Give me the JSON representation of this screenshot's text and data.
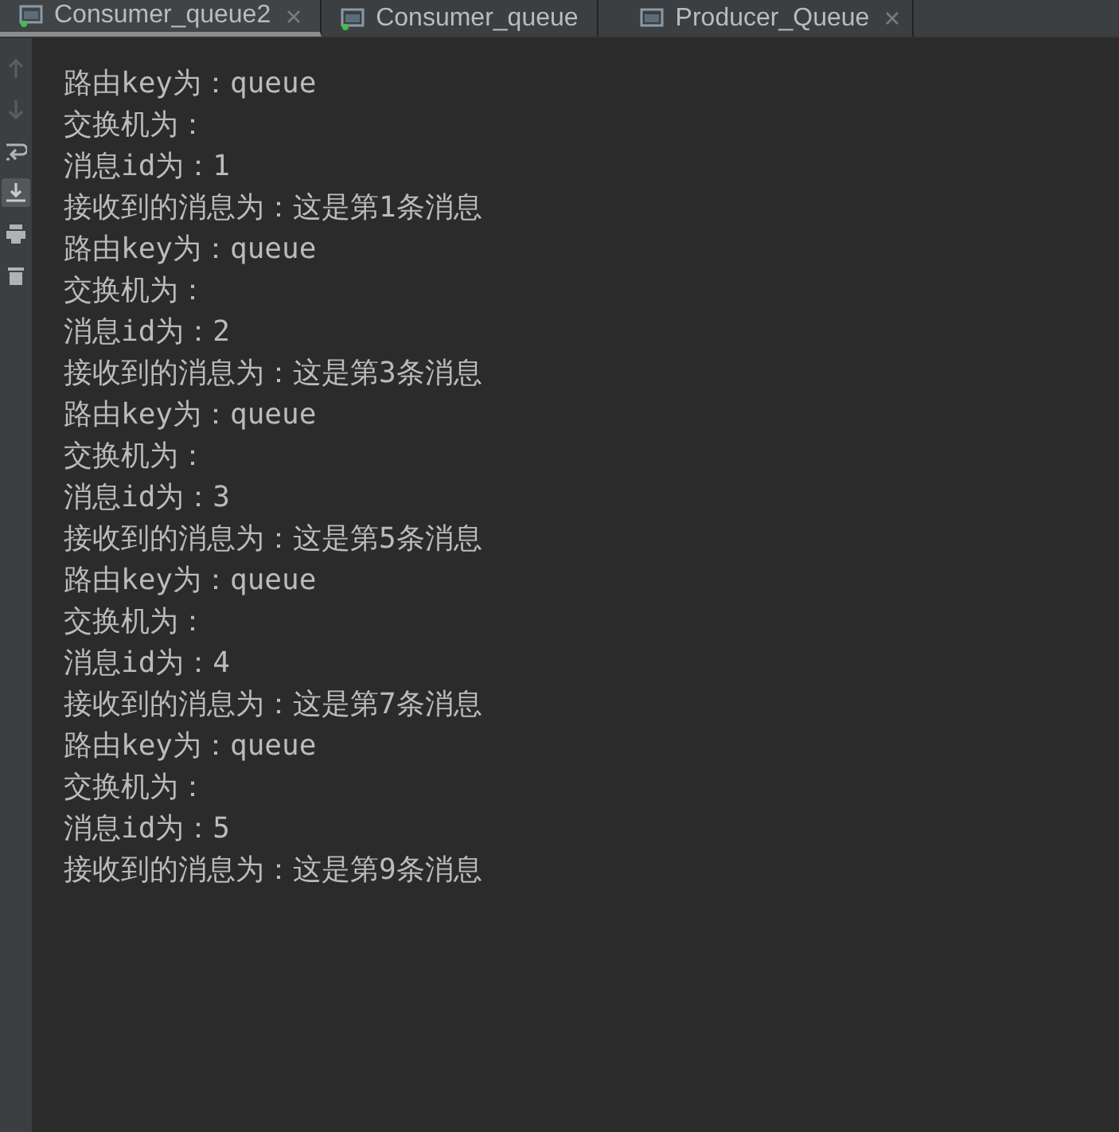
{
  "tabs": [
    {
      "label": "Consumer_queue2",
      "selected": true,
      "running": true,
      "closable": true
    },
    {
      "label": "Consumer_queue",
      "selected": false,
      "running": true,
      "closable": false
    },
    {
      "label": "Producer_Queue",
      "selected": false,
      "running": false,
      "closable": true
    }
  ],
  "toolbar": [
    {
      "kind": "up",
      "on": false
    },
    {
      "kind": "down",
      "on": false
    },
    {
      "kind": "wrap",
      "on": false
    },
    {
      "kind": "scroll-end",
      "on": true
    },
    {
      "kind": "print",
      "on": false
    },
    {
      "kind": "trash",
      "on": false
    }
  ],
  "console_lines": [
    "路由key为：queue",
    "交换机为：",
    "消息id为：1",
    "接收到的消息为：这是第1条消息",
    "路由key为：queue",
    "交换机为：",
    "消息id为：2",
    "接收到的消息为：这是第3条消息",
    "路由key为：queue",
    "交换机为：",
    "消息id为：3",
    "接收到的消息为：这是第5条消息",
    "路由key为：queue",
    "交换机为：",
    "消息id为：4",
    "接收到的消息为：这是第7条消息",
    "路由key为：queue",
    "交换机为：",
    "消息id为：5",
    "接收到的消息为：这是第9条消息"
  ]
}
